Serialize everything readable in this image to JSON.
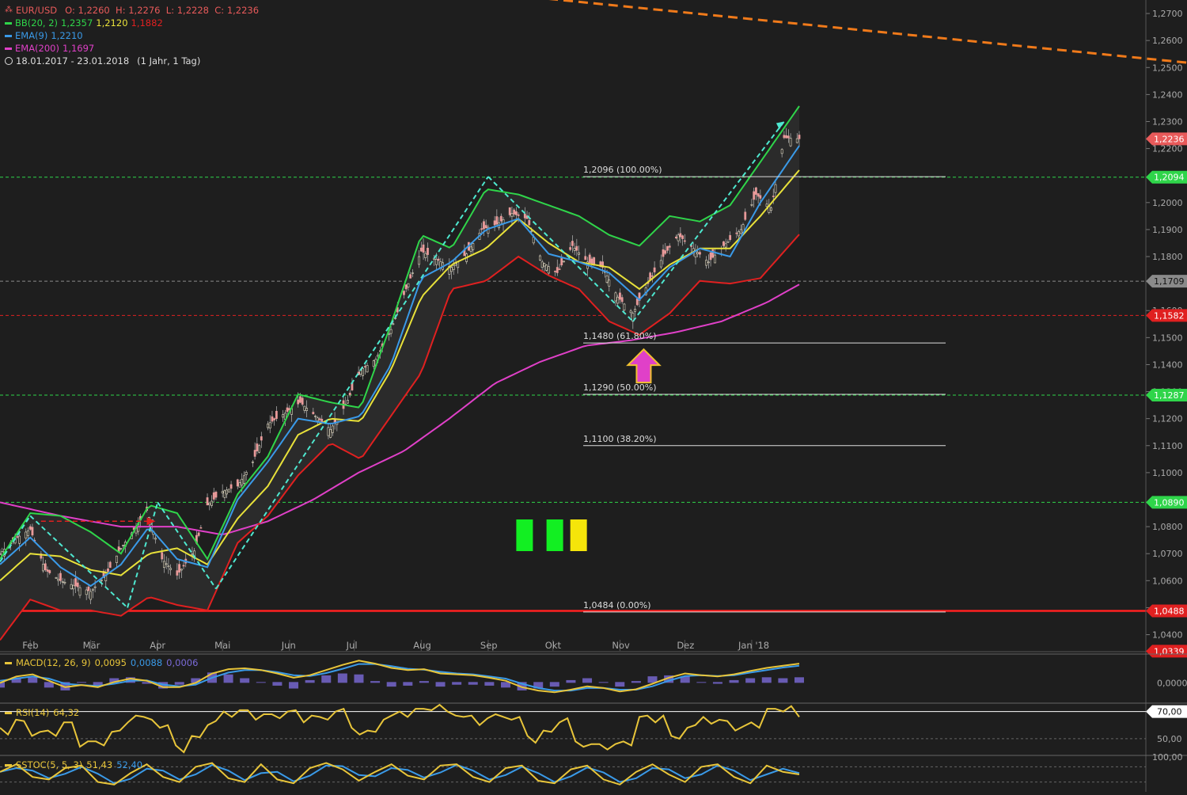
{
  "header": {
    "symbol": "EUR/USD",
    "ohlc": "O: 1,2260  H: 1,2276  L: 1,2228  C: 1,2236",
    "range_text": "18.01.2017 - 23.01.2018",
    "interval_text": "(1 Jahr, 1 Tag)",
    "indicators": [
      {
        "name": "BB(20, 2)",
        "values": [
          "1,2357",
          "1,2120",
          "1,1882"
        ],
        "value_colors": [
          "#2fd54a",
          "#e8e13a",
          "#e02020"
        ],
        "color": "#2fd54a"
      },
      {
        "name": "EMA(9)",
        "values": [
          "1,2210"
        ],
        "value_colors": [
          "#3a9ae8"
        ],
        "color": "#3a9ae8"
      },
      {
        "name": "EMA(200)",
        "values": [
          "1,1697"
        ],
        "value_colors": [
          "#e040c8"
        ],
        "color": "#e040c8"
      }
    ]
  },
  "colors": {
    "background": "#1e1e1e",
    "bb_upper": "#2fd54a",
    "bb_mid": "#e8e13a",
    "bb_lower": "#e02020",
    "ema9": "#3a9ae8",
    "ema200": "#e040c8",
    "trend_dashed": "#4ee8d0",
    "resistance_dashed": "#f07a1a",
    "axis_text": "#aaaaaa"
  },
  "chart_data": {
    "type": "candlestick",
    "ylim": [
      1.034,
      1.275
    ],
    "yticks": [
      "1,2700",
      "1,2600",
      "1,2500",
      "1,2400",
      "1,2300",
      "1,2200",
      "1,2000",
      "1,1900",
      "1,1800",
      "1,1600",
      "1,1500",
      "1,1400",
      "1,1300",
      "1,1200",
      "1,1100",
      "1,1000",
      "1,0800",
      "1,0700",
      "1,0600",
      "1,0500",
      "1,0400"
    ],
    "ytick_values": [
      1.27,
      1.26,
      1.25,
      1.24,
      1.23,
      1.22,
      1.2,
      1.19,
      1.18,
      1.16,
      1.15,
      1.14,
      1.13,
      1.12,
      1.11,
      1.1,
      1.08,
      1.07,
      1.06,
      1.05,
      1.04
    ],
    "xaxis": {
      "start": "2017-01-18",
      "end": "2018-01-23",
      "labels": [
        "Feb",
        "Mär",
        "Apr",
        "Mai",
        "Jun",
        "Jul",
        "Aug",
        "Sep",
        "Okt",
        "Nov",
        "Dez",
        "Jan '18"
      ],
      "label_dates": [
        "2017-02-01",
        "2017-03-01",
        "2017-04-01",
        "2017-05-01",
        "2017-06-01",
        "2017-07-01",
        "2017-08-01",
        "2017-09-01",
        "2017-10-01",
        "2017-11-01",
        "2017-12-01",
        "2018-01-01"
      ]
    },
    "close_path": {
      "dates": [
        "2017-01-18",
        "2017-01-24",
        "2017-02-01",
        "2017-02-08",
        "2017-02-15",
        "2017-02-22",
        "2017-03-01",
        "2017-03-08",
        "2017-03-15",
        "2017-03-22",
        "2017-03-27",
        "2017-04-03",
        "2017-04-10",
        "2017-04-18",
        "2017-04-24",
        "2017-05-01",
        "2017-05-08",
        "2017-05-15",
        "2017-05-22",
        "2017-05-30",
        "2017-06-06",
        "2017-06-13",
        "2017-06-20",
        "2017-06-27",
        "2017-07-04",
        "2017-07-11",
        "2017-07-18",
        "2017-07-25",
        "2017-08-01",
        "2017-08-08",
        "2017-08-15",
        "2017-08-22",
        "2017-08-29",
        "2017-09-05",
        "2017-09-12",
        "2017-09-19",
        "2017-09-26",
        "2017-10-03",
        "2017-10-10",
        "2017-10-17",
        "2017-10-24",
        "2017-10-31",
        "2017-11-07",
        "2017-11-14",
        "2017-11-21",
        "2017-11-28",
        "2017-12-05",
        "2017-12-12",
        "2017-12-19",
        "2017-12-27",
        "2018-01-03",
        "2018-01-10",
        "2018-01-16",
        "2018-01-23"
      ],
      "close": [
        1.07,
        1.075,
        1.079,
        1.064,
        1.06,
        1.058,
        1.056,
        1.062,
        1.072,
        1.08,
        1.086,
        1.068,
        1.062,
        1.071,
        1.088,
        1.093,
        1.095,
        1.104,
        1.118,
        1.122,
        1.126,
        1.121,
        1.116,
        1.125,
        1.138,
        1.142,
        1.153,
        1.168,
        1.182,
        1.179,
        1.176,
        1.181,
        1.19,
        1.192,
        1.196,
        1.194,
        1.178,
        1.174,
        1.184,
        1.178,
        1.176,
        1.165,
        1.159,
        1.17,
        1.18,
        1.188,
        1.183,
        1.178,
        1.184,
        1.19,
        1.203,
        1.198,
        1.224,
        1.2236
      ]
    },
    "bb_upper_path": {
      "dates": [
        "2017-01-18",
        "2017-02-01",
        "2017-02-15",
        "2017-03-01",
        "2017-03-15",
        "2017-03-28",
        "2017-04-10",
        "2017-04-24",
        "2017-05-08",
        "2017-05-22",
        "2017-06-05",
        "2017-06-20",
        "2017-07-04",
        "2017-07-18",
        "2017-08-01",
        "2017-08-15",
        "2017-08-31",
        "2017-09-15",
        "2017-09-29",
        "2017-10-13",
        "2017-10-27",
        "2017-11-10",
        "2017-11-24",
        "2017-12-08",
        "2017-12-22",
        "2018-01-05",
        "2018-01-23"
      ],
      "values": [
        1.068,
        1.085,
        1.084,
        1.078,
        1.07,
        1.088,
        1.085,
        1.068,
        1.092,
        1.106,
        1.129,
        1.126,
        1.124,
        1.155,
        1.188,
        1.183,
        1.205,
        1.203,
        1.199,
        1.195,
        1.188,
        1.184,
        1.195,
        1.193,
        1.199,
        1.215,
        1.2357
      ]
    },
    "bb_mid_path": {
      "dates": [
        "2017-01-18",
        "2017-02-01",
        "2017-02-15",
        "2017-03-01",
        "2017-03-15",
        "2017-03-28",
        "2017-04-10",
        "2017-04-24",
        "2017-05-08",
        "2017-05-22",
        "2017-06-05",
        "2017-06-20",
        "2017-07-04",
        "2017-07-18",
        "2017-08-01",
        "2017-08-15",
        "2017-08-31",
        "2017-09-15",
        "2017-09-29",
        "2017-10-13",
        "2017-10-27",
        "2017-11-10",
        "2017-11-24",
        "2017-12-08",
        "2017-12-22",
        "2018-01-05",
        "2018-01-23"
      ],
      "values": [
        1.06,
        1.07,
        1.069,
        1.064,
        1.062,
        1.07,
        1.072,
        1.066,
        1.083,
        1.095,
        1.114,
        1.12,
        1.119,
        1.138,
        1.165,
        1.177,
        1.183,
        1.194,
        1.185,
        1.178,
        1.176,
        1.168,
        1.177,
        1.183,
        1.183,
        1.195,
        1.212
      ]
    },
    "bb_lower_path": {
      "dates": [
        "2017-01-18",
        "2017-02-01",
        "2017-02-15",
        "2017-03-01",
        "2017-03-15",
        "2017-03-28",
        "2017-04-10",
        "2017-04-24",
        "2017-05-08",
        "2017-05-22",
        "2017-06-05",
        "2017-06-20",
        "2017-07-04",
        "2017-07-18",
        "2017-08-01",
        "2017-08-15",
        "2017-08-31",
        "2017-09-15",
        "2017-09-29",
        "2017-10-13",
        "2017-10-27",
        "2017-11-10",
        "2017-11-24",
        "2017-12-08",
        "2017-12-22",
        "2018-01-05",
        "2018-01-23"
      ],
      "values": [
        1.038,
        1.053,
        1.049,
        1.049,
        1.047,
        1.054,
        1.051,
        1.049,
        1.074,
        1.084,
        1.099,
        1.111,
        1.105,
        1.121,
        1.137,
        1.168,
        1.171,
        1.18,
        1.173,
        1.168,
        1.156,
        1.151,
        1.159,
        1.171,
        1.17,
        1.172,
        1.1882
      ]
    },
    "ema9_path": {
      "dates": [
        "2017-01-18",
        "2017-02-01",
        "2017-02-15",
        "2017-03-01",
        "2017-03-15",
        "2017-03-28",
        "2017-04-10",
        "2017-04-24",
        "2017-05-08",
        "2017-05-22",
        "2017-06-05",
        "2017-06-20",
        "2017-07-04",
        "2017-07-18",
        "2017-08-01",
        "2017-08-15",
        "2017-08-31",
        "2017-09-15",
        "2017-09-29",
        "2017-10-13",
        "2017-10-27",
        "2017-11-10",
        "2017-11-24",
        "2017-12-08",
        "2017-12-22",
        "2018-01-05",
        "2018-01-23"
      ],
      "values": [
        1.066,
        1.076,
        1.065,
        1.058,
        1.066,
        1.08,
        1.068,
        1.065,
        1.09,
        1.104,
        1.12,
        1.118,
        1.121,
        1.14,
        1.172,
        1.178,
        1.19,
        1.194,
        1.181,
        1.178,
        1.174,
        1.164,
        1.176,
        1.183,
        1.18,
        1.2,
        1.221
      ]
    },
    "ema200_path": {
      "dates": [
        "2017-01-18",
        "2017-02-15",
        "2017-03-15",
        "2017-04-10",
        "2017-05-01",
        "2017-05-22",
        "2017-06-12",
        "2017-07-03",
        "2017-07-24",
        "2017-08-14",
        "2017-09-04",
        "2017-09-25",
        "2017-10-16",
        "2017-11-06",
        "2017-11-27",
        "2017-12-18",
        "2018-01-08",
        "2018-01-23"
      ],
      "values": [
        1.089,
        1.084,
        1.08,
        1.08,
        1.077,
        1.082,
        1.09,
        1.1,
        1.108,
        1.12,
        1.133,
        1.141,
        1.147,
        1.149,
        1.152,
        1.156,
        1.163,
        1.1697
      ]
    },
    "price_tags": [
      {
        "label": "1,2236",
        "value": 1.2236,
        "color": "#e85a5a"
      },
      {
        "label": "1,2094",
        "value": 1.2094,
        "color": "#2fd54a"
      },
      {
        "label": "1,1709",
        "value": 1.1709,
        "color": "#8a8a8a"
      },
      {
        "label": "1,1582",
        "value": 1.1582,
        "color": "#e02020"
      },
      {
        "label": "1,1287",
        "value": 1.1287,
        "color": "#2fd54a"
      },
      {
        "label": "1,0890",
        "value": 1.089,
        "color": "#2fd54a"
      },
      {
        "label": "1,0488",
        "value": 1.0488,
        "color": "#e02020"
      },
      {
        "label": "1,0339",
        "value": 1.0339,
        "color": "#e02020"
      }
    ],
    "horizontal_lines": [
      {
        "value": 1.2094,
        "style": "dashed",
        "color": "#2fd54a"
      },
      {
        "value": 1.1709,
        "style": "dashed",
        "color": "#8a8a8a"
      },
      {
        "value": 1.1582,
        "style": "dashed",
        "color": "#e02020"
      },
      {
        "value": 1.1287,
        "style": "dashed",
        "color": "#2fd54a"
      },
      {
        "value": 1.089,
        "style": "dashed",
        "color": "#2fd54a"
      },
      {
        "value": 1.0488,
        "style": "solid",
        "color": "#ff2020"
      }
    ],
    "fibonacci": [
      {
        "label": "1,2096 (100.00%)",
        "value": 1.2096,
        "color": "#dddddd"
      },
      {
        "label": "1,1480 (61.80%)",
        "value": 1.148,
        "color": "#dddddd"
      },
      {
        "label": "1,1290 (50.00%)",
        "value": 1.129,
        "color": "#dddddd"
      },
      {
        "label": "1,1100 (38.20%)",
        "value": 1.11,
        "color": "#dddddd"
      },
      {
        "label": "1,0484 (0.00%)",
        "value": 1.0484,
        "color": "#dddddd"
      }
    ],
    "signal_blocks": [
      {
        "date": "2017-09-14",
        "color": "#12ef22"
      },
      {
        "date": "2017-09-28",
        "color": "#12ef22"
      },
      {
        "date": "2017-10-09",
        "color": "#f5e50a"
      }
    ],
    "arrow_up": {
      "date": "2017-11-12",
      "value": 1.148,
      "color": "#e040c8"
    },
    "orange_resistance": {
      "start": {
        "date": "2017-09-22",
        "value": 1.276
      },
      "end": {
        "date": "2018-01-23",
        "value": 1.2518
      }
    },
    "trend_lines": [
      [
        {
          "date": "2017-01-18",
          "value": 1.067
        },
        {
          "date": "2017-02-01",
          "value": 1.084
        }
      ],
      [
        {
          "date": "2017-02-01",
          "value": 1.084
        },
        {
          "date": "2017-03-18",
          "value": 1.05
        }
      ],
      [
        {
          "date": "2017-03-18",
          "value": 1.05
        },
        {
          "date": "2017-04-01",
          "value": 1.089
        }
      ],
      [
        {
          "date": "2017-04-01",
          "value": 1.089
        },
        {
          "date": "2017-04-28",
          "value": 1.057
        }
      ],
      [
        {
          "date": "2017-04-28",
          "value": 1.057
        },
        {
          "date": "2017-09-01",
          "value": 1.2096
        }
      ],
      [
        {
          "date": "2017-09-01",
          "value": 1.2096
        },
        {
          "date": "2017-11-07",
          "value": 1.156
        }
      ],
      [
        {
          "date": "2017-11-07",
          "value": 1.156
        },
        {
          "date": "2018-01-16",
          "value": 1.23
        }
      ]
    ],
    "red_arrow": {
      "start": {
        "date": "2017-02-06",
        "value": 1.082
      },
      "end": {
        "date": "2017-03-31",
        "value": 1.082
      }
    }
  },
  "macd": {
    "label": "MACD(12, 26, 9)",
    "values": [
      "0,0095",
      "0,0088",
      "0,0006"
    ],
    "value_colors": [
      "#e8c53a",
      "#3a9ae8",
      "#7a6ad8"
    ],
    "tick": "0,0000",
    "macd_path": [
      0.4,
      0.55,
      0.6,
      0.45,
      0.3,
      0.35,
      0.3,
      0.42,
      0.5,
      0.45,
      0.3,
      0.3,
      0.4,
      0.62,
      0.72,
      0.74,
      0.7,
      0.62,
      0.52,
      0.58,
      0.7,
      0.82,
      0.92,
      0.85,
      0.75,
      0.7,
      0.72,
      0.62,
      0.6,
      0.58,
      0.52,
      0.45,
      0.3,
      0.22,
      0.18,
      0.24,
      0.32,
      0.28,
      0.2,
      0.25,
      0.38,
      0.52,
      0.62,
      0.58,
      0.55,
      0.6,
      0.68,
      0.75,
      0.8,
      0.85
    ],
    "signal_path": [
      0.45,
      0.5,
      0.55,
      0.5,
      0.38,
      0.35,
      0.33,
      0.38,
      0.45,
      0.46,
      0.36,
      0.32,
      0.36,
      0.52,
      0.64,
      0.7,
      0.7,
      0.65,
      0.58,
      0.56,
      0.63,
      0.73,
      0.84,
      0.84,
      0.79,
      0.73,
      0.71,
      0.66,
      0.62,
      0.6,
      0.55,
      0.5,
      0.38,
      0.28,
      0.22,
      0.22,
      0.28,
      0.28,
      0.24,
      0.24,
      0.32,
      0.45,
      0.56,
      0.58,
      0.56,
      0.58,
      0.64,
      0.7,
      0.76,
      0.8
    ]
  },
  "rsi": {
    "label": "RSI(14)",
    "value": "64,32",
    "ticks": [
      "70,00",
      "50,00"
    ],
    "tick_values": [
      70,
      50
    ],
    "series": [
      58,
      64,
      52,
      56,
      62,
      44,
      48,
      55,
      62,
      66,
      58,
      45,
      52,
      60,
      70,
      71,
      64,
      68,
      70,
      62,
      66,
      70,
      58,
      56,
      64,
      70,
      72,
      71,
      70,
      66,
      60,
      68,
      64,
      52,
      56,
      62,
      48,
      46,
      42,
      48,
      66,
      62,
      52,
      58,
      66,
      64,
      56,
      62,
      72,
      70,
      66
    ]
  },
  "sstoc": {
    "label": "SSTOC(5, 5, 3)",
    "values": [
      "51,43",
      "52,40"
    ],
    "value_colors": [
      "#e8c53a",
      "#3a9ae8"
    ],
    "ticks": [
      "100,00"
    ],
    "series": [
      60,
      90,
      40,
      30,
      75,
      85,
      20,
      10,
      55,
      90,
      40,
      20,
      80,
      95,
      35,
      20,
      90,
      30,
      15,
      75,
      95,
      70,
      25,
      60,
      90,
      45,
      30,
      85,
      90,
      40,
      20,
      75,
      85,
      25,
      15,
      70,
      85,
      30,
      10,
      60,
      90,
      50,
      20,
      80,
      90,
      40,
      15,
      85,
      60,
      50
    ]
  }
}
